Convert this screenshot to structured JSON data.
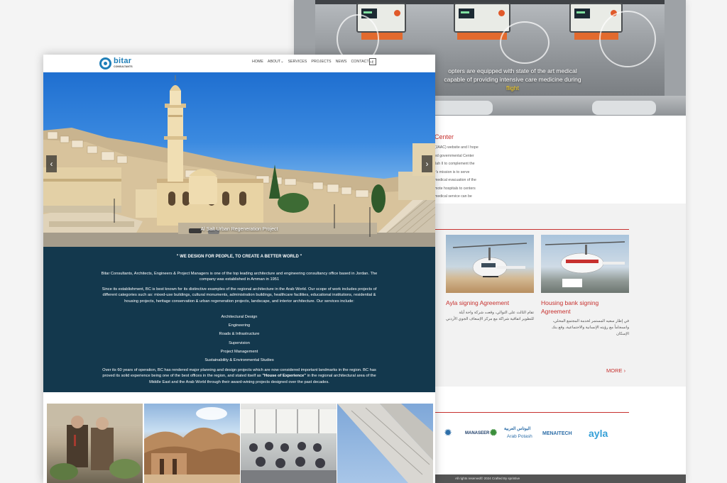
{
  "back_page": {
    "hero_caption_line1": "opters are equipped with state of the art medical",
    "hero_caption_line2": "capable of providing intensive care medicine during",
    "hero_caption_line3": "flight",
    "welcome_title": "Center",
    "welcome_lines": [
      "(JAAC) website and I hope",
      "ed governmental Center",
      "llah II to complement the",
      "r's mission is to serve",
      "medical evacuation of the",
      "mote hospitals to centers",
      "medical service can be"
    ],
    "news": [
      {
        "title": "Ayla signing Agreement",
        "arabic": "تقام الثالث على التوالي، وقعت شركة واحة أيلة للتطوير اتفاقية شراكة مع مركز الإسعاف الجوي الأردني"
      },
      {
        "title": "Housing bank signing Agreement",
        "arabic": "في إطار سعيه المستمر لخدمة المجتمع المحلي، وانسجاماً مع رؤيته الإنسانية والاجتماعية، وقع بنك الإسكان"
      }
    ],
    "more_label": "MORE",
    "partners": [
      "MANASEER",
      "البوتاس العربية",
      "Arab Potash",
      "MENAITECH",
      "ayla"
    ],
    "footer": "All rights reserved© 2024 Crafted By sprintive"
  },
  "front_page": {
    "logo": {
      "name": "bitar",
      "sub": "CONSULTANTS"
    },
    "menu": [
      "HOME",
      "ABOUT",
      "SERVICES",
      "PROJECTS",
      "NEWS",
      "CONTACT"
    ],
    "lang_label": "ع",
    "hero_caption": "Al Salt Urban Regeneration Project",
    "about": {
      "heading": "\" WE DESIGN FOR PEOPLE, TO CREATE A BETTER WORLD \"",
      "p1": "Bitar Consultants, Architects, Engineers & Project Managers is one of the top leading architecture and engineering consultancy office based in Jordan. The company was established in Amman in 1951",
      "p2": "Since its establishment, BC is best known for its distinctive examples of the regional architecture in the Arab World. Our scope of work includes projects of different categories such as: mixed-use buildings, cultural monuments, administration buildings, healthcare facilities, educational institutions, residential & housing projects, heritage conservation & urban regeneration projects, landscape, and interior architecture. Our services include:",
      "services": [
        "Architectural Design",
        "Engineering",
        "Roads & Infrastructure",
        "Supervision",
        "Project Management",
        "Sustainability & Environmental Studies"
      ],
      "p3_before": "Over its 60 years of operation, BC has rendered major planning and design projects which are now considered important landmarks in the region. BC has proved its solid experience being one of the best offices in the region, and stated itself as ",
      "p3_bold": "\"House of Experience\"",
      "p3_after": " in the regional architectural area of the Middle East and the Arab World through their award-wining projects designed over the past decades."
    }
  },
  "colors": {
    "navy": "#13384d",
    "accent_red": "#c7312f",
    "logo_blue": "#1f7fb8"
  }
}
